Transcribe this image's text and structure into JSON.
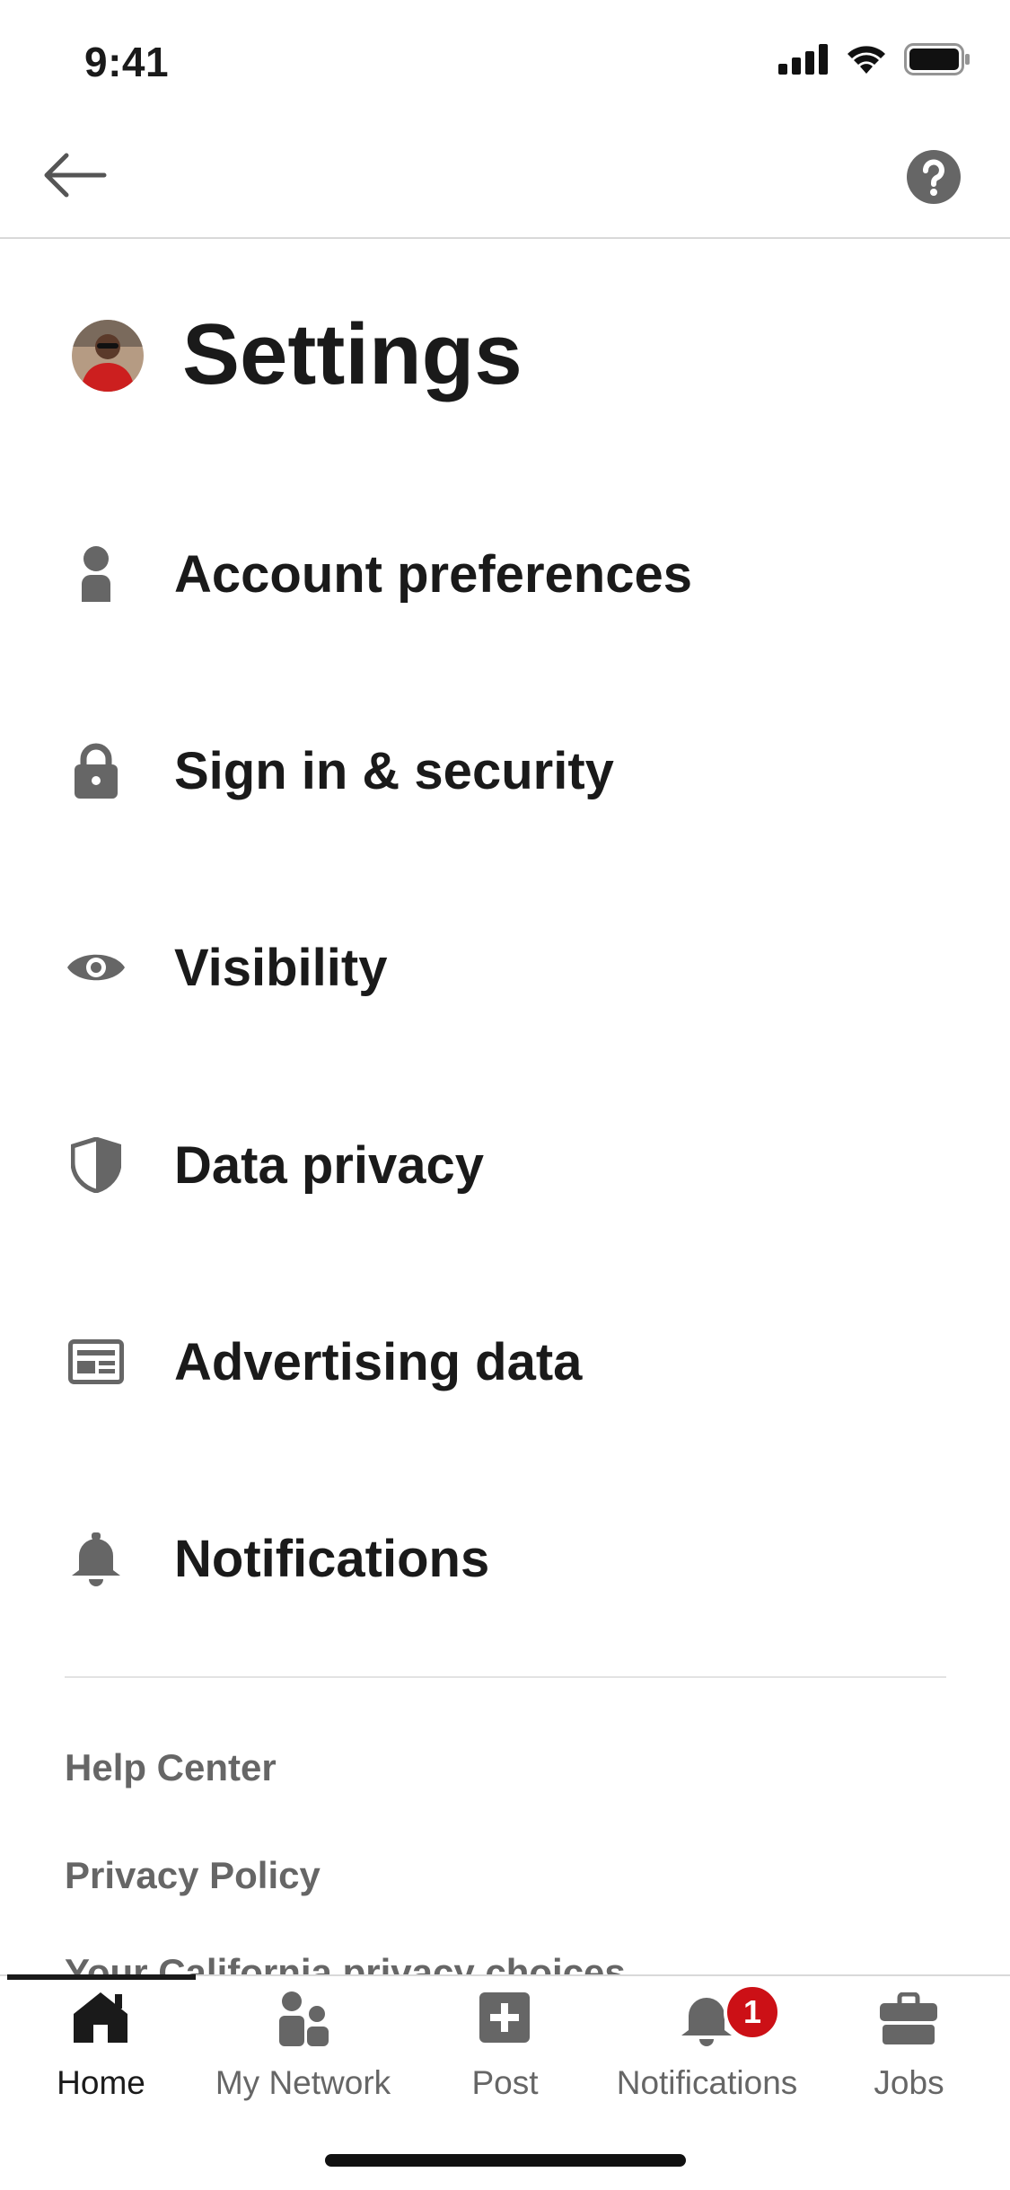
{
  "status_bar": {
    "time": "9:41"
  },
  "page": {
    "title": "Settings"
  },
  "menu": {
    "items": [
      {
        "label": "Account preferences",
        "icon": "person-icon"
      },
      {
        "label": "Sign in & security",
        "icon": "lock-icon"
      },
      {
        "label": "Visibility",
        "icon": "eye-icon"
      },
      {
        "label": "Data privacy",
        "icon": "shield-icon"
      },
      {
        "label": "Advertising data",
        "icon": "ad-card-icon"
      },
      {
        "label": "Notifications",
        "icon": "bell-icon"
      }
    ]
  },
  "footer": {
    "links": [
      "Help Center",
      "Privacy Policy"
    ],
    "partial_link": "Your California privacy choices"
  },
  "tabs": [
    {
      "label": "Home",
      "icon": "home-icon",
      "active": true
    },
    {
      "label": "My Network",
      "icon": "network-icon",
      "active": false
    },
    {
      "label": "Post",
      "icon": "post-icon",
      "active": false
    },
    {
      "label": "Notifications",
      "icon": "bell-icon",
      "active": false,
      "badge": "1"
    },
    {
      "label": "Jobs",
      "icon": "briefcase-icon",
      "active": false
    }
  ],
  "colors": {
    "icon_gray": "#666666",
    "text_dark": "#1a1a1a",
    "badge_red": "#cc1016"
  }
}
